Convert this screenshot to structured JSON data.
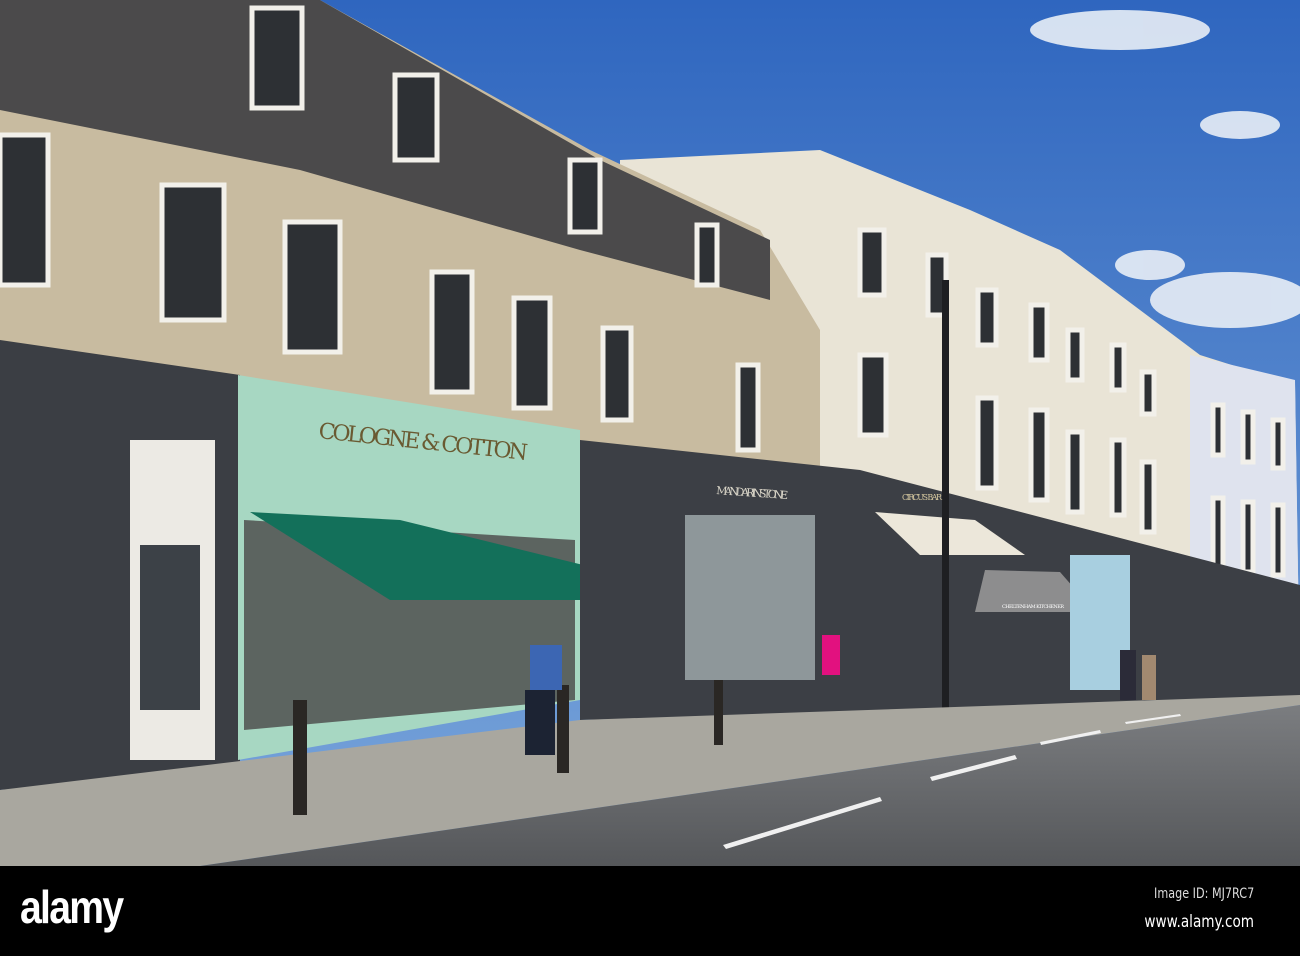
{
  "photo": {
    "signs": {
      "cologne_cotton": "COLOGNE & COTTON",
      "mandarinstone": "MANDARINSTONE",
      "circus_bar": "CIRCUS BAR",
      "cheltenham_kitchener": "CHELTENHAM KITCHENER"
    },
    "colors": {
      "sky": "#3f78c8",
      "awning": "#13705a",
      "stone": "#c9bda3",
      "road": "#6e6f72"
    }
  },
  "watermark": {
    "logo": "alamy",
    "image_id": "Image ID: MJ7RC7",
    "url": "www.alamy.com"
  }
}
